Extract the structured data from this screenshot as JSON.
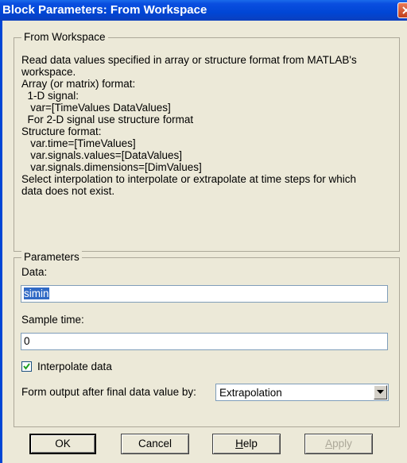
{
  "window": {
    "title": "Block Parameters: From Workspace"
  },
  "description": {
    "legend": "From Workspace",
    "lines": [
      "Read data values specified in array or structure format from MATLAB's",
      "workspace.",
      "Array (or matrix) format:",
      "  1-D signal:",
      "   var=[TimeValues DataValues]",
      "  For 2-D signal use structure format",
      "Structure format:",
      "   var.time=[TimeValues]",
      "   var.signals.values=[DataValues]",
      "   var.signals.dimensions=[DimValues]",
      "Select interpolation to interpolate or extrapolate at time steps for which",
      "data does not exist."
    ]
  },
  "parameters": {
    "legend": "Parameters",
    "data_label": "Data:",
    "data_value": "simin",
    "sample_time_label": "Sample time:",
    "sample_time_value": "0",
    "interpolate_label": "Interpolate data",
    "interpolate_checked": true,
    "form_output_label": "Form output after final data value by:",
    "form_output_value": "Extrapolation"
  },
  "buttons": {
    "ok": "OK",
    "cancel": "Cancel",
    "help_prefix": "H",
    "help_rest": "elp",
    "apply_prefix": "A",
    "apply_rest": "pply"
  }
}
